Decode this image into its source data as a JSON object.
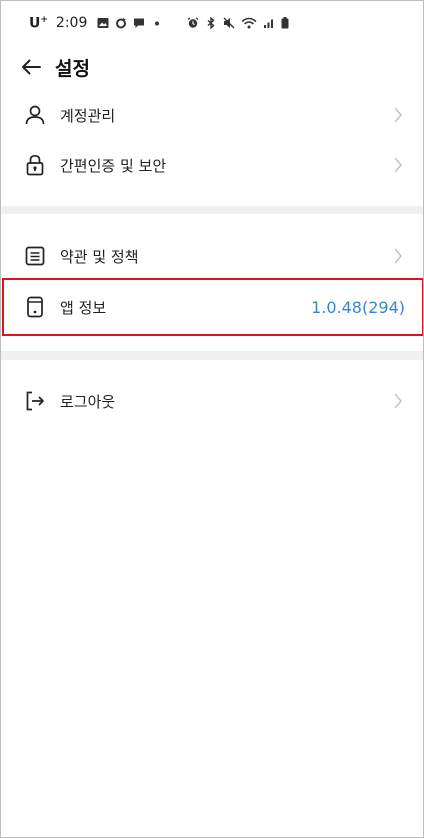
{
  "status_bar": {
    "carrier": "U",
    "carrier_sup": "+",
    "time": "2:09",
    "left_icons": [
      "image-icon",
      "sync-icon",
      "chat-icon",
      "dot-icon"
    ],
    "right_icons": [
      "alarm-icon",
      "bluetooth-icon",
      "mute-icon",
      "wifi-icon",
      "signal-icon",
      "battery-icon"
    ]
  },
  "header": {
    "title": "설정",
    "back_icon": "arrow-left-icon"
  },
  "settings": {
    "account": {
      "label": "계정관리",
      "icon": "person-icon"
    },
    "auth": {
      "label": "간편인증 및 보안",
      "icon": "lock-icon"
    },
    "terms": {
      "label": "약관 및 정책",
      "icon": "document-icon"
    },
    "app_info": {
      "label": "앱 정보",
      "icon": "phone-icon",
      "version": "1.0.48(294)"
    },
    "logout": {
      "label": "로그아웃",
      "icon": "logout-icon"
    }
  },
  "colors": {
    "accent": "#3a86d1",
    "highlight": "#d9161d",
    "separator": "#f0f0f0"
  }
}
